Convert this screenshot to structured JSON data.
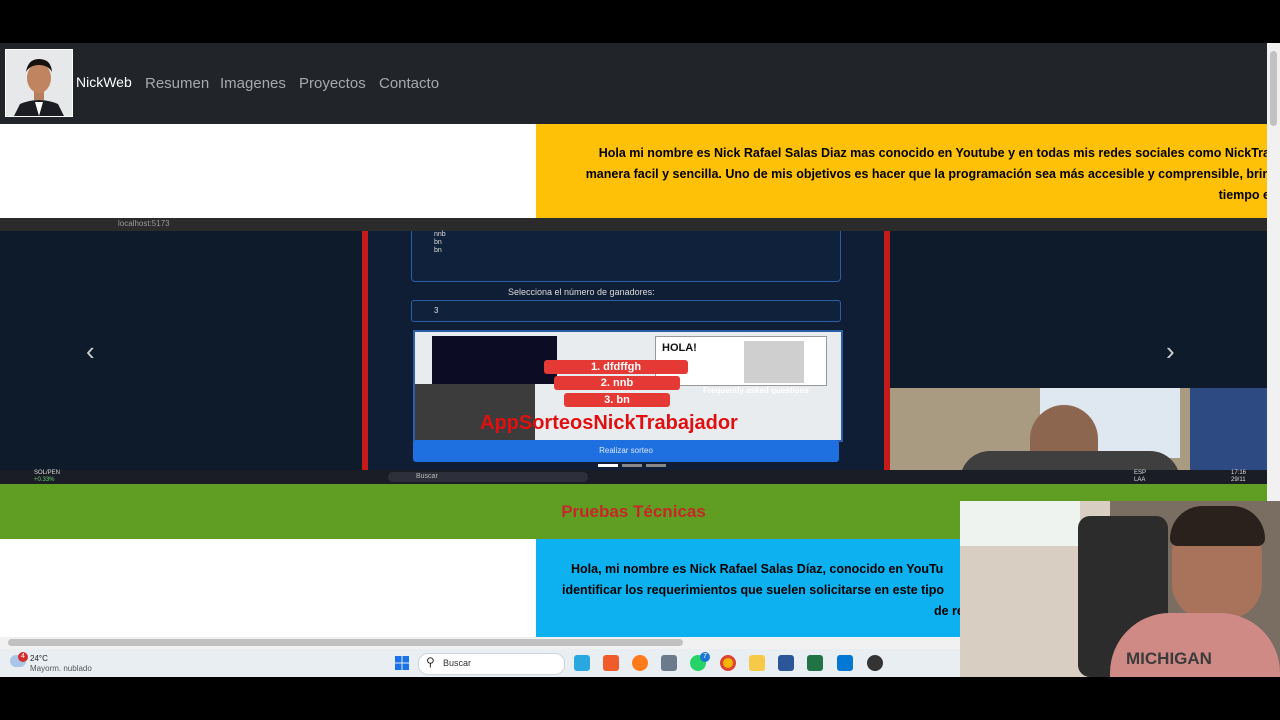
{
  "navbar": {
    "brand": "NickWeb",
    "links": [
      "Resumen",
      "Imagenes",
      "Proyectos",
      "Contacto"
    ]
  },
  "intro": {
    "line1": "Hola mi nombre es Nick Rafael Salas Diaz mas conocido en Youtube y en todas mis redes sociales como NickTra",
    "line2": "manera facil y sencilla. Uno de mis objetivos es hacer que la programación sea más accesible y comprensible, brin",
    "line3": "tiempo e"
  },
  "carousel": {
    "browser_url": "localhost:5173",
    "items_text": [
      "nnb",
      "bn",
      "bn"
    ],
    "select_label": "Selecciona el número de ganadores:",
    "winners_count": "3",
    "winners": [
      "1. dfdffgh",
      "2. nnb",
      "3. bn"
    ],
    "app_title": "AppSorteosNickTrabajador",
    "hola_text": "HOLA!",
    "faq_text": "Frequently asked questions",
    "button_label": "Realizar sorteo",
    "prev_icon": "‹",
    "next_icon": "›",
    "inner_taskbar": {
      "stock": "SOL/PEN",
      "stock_change": "+0.33%",
      "search": "Buscar",
      "lang": "ESP",
      "region": "LAA",
      "time": "17:16",
      "date": "29/11"
    }
  },
  "section2": {
    "heading": "Pruebas Técnicas",
    "line1": "Hola, mi nombre es Nick Rafael Salas Díaz, conocido en YouTu",
    "line2": "identificar los requerimientos que suelen solicitarse en este tipo",
    "line3": "de re"
  },
  "taskbar": {
    "weather_badge": "4",
    "temperature": "24°C",
    "weather_desc": "Mayorm. nublado",
    "search_placeholder": "Buscar",
    "notif_badge": "7"
  },
  "webcam": {
    "shirt_text": "MICHIGAN"
  },
  "colors": {
    "navbar": "#212529",
    "yellow": "#ffc107",
    "green": "#5f9e22",
    "blue": "#0db1ef",
    "heading_red": "#c62828"
  }
}
